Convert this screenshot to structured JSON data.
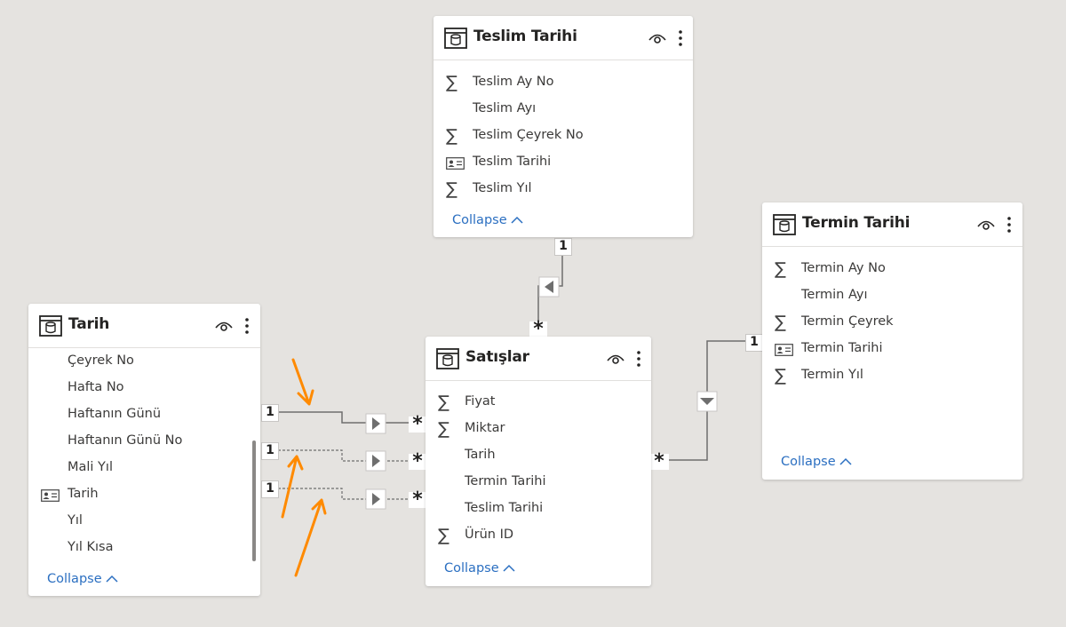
{
  "tables": [
    {
      "key": "teslim",
      "title": "Teslim Tarihi",
      "fields": [
        {
          "icon": "sigma",
          "label": "Teslim Ay No"
        },
        {
          "icon": "none",
          "label": "Teslim Ayı"
        },
        {
          "icon": "sigma",
          "label": "Teslim Çeyrek No"
        },
        {
          "icon": "id-card",
          "label": "Teslim Tarihi"
        },
        {
          "icon": "sigma",
          "label": "Teslim Yıl"
        }
      ],
      "collapse_label": "Collapse"
    },
    {
      "key": "termin",
      "title": "Termin Tarihi",
      "fields": [
        {
          "icon": "sigma",
          "label": "Termin Ay No"
        },
        {
          "icon": "none",
          "label": "Termin Ayı"
        },
        {
          "icon": "sigma",
          "label": "Termin Çeyrek"
        },
        {
          "icon": "id-card",
          "label": "Termin Tarihi"
        },
        {
          "icon": "sigma",
          "label": "Termin Yıl"
        }
      ],
      "collapse_label": "Collapse"
    },
    {
      "key": "tarih",
      "title": "Tarih",
      "fields": [
        {
          "icon": "none",
          "label": "Çeyrek No"
        },
        {
          "icon": "none",
          "label": "Hafta No"
        },
        {
          "icon": "none",
          "label": "Haftanın Günü"
        },
        {
          "icon": "none",
          "label": "Haftanın Günü No"
        },
        {
          "icon": "none",
          "label": "Mali Yıl"
        },
        {
          "icon": "id-card",
          "label": "Tarih"
        },
        {
          "icon": "none",
          "label": "Yıl"
        },
        {
          "icon": "none",
          "label": "Yıl Kısa"
        }
      ],
      "collapse_label": "Collapse"
    },
    {
      "key": "satislar",
      "title": "Satışlar",
      "fields": [
        {
          "icon": "sigma",
          "label": "Fiyat"
        },
        {
          "icon": "sigma",
          "label": "Miktar"
        },
        {
          "icon": "none",
          "label": "Tarih"
        },
        {
          "icon": "none",
          "label": "Termin Tarihi"
        },
        {
          "icon": "none",
          "label": "Teslim Tarihi"
        },
        {
          "icon": "sigma",
          "label": "Ürün ID"
        }
      ],
      "collapse_label": "Collapse"
    }
  ],
  "relationships": [
    {
      "from": "tarih",
      "to": "satislar",
      "from_cardinality": "1",
      "to_cardinality": "*",
      "active": true
    },
    {
      "from": "tarih",
      "to": "satislar",
      "from_cardinality": "1",
      "to_cardinality": "*",
      "active": false
    },
    {
      "from": "tarih",
      "to": "satislar",
      "from_cardinality": "1",
      "to_cardinality": "*",
      "active": false
    },
    {
      "from": "teslim",
      "to": "satislar",
      "from_cardinality": "1",
      "to_cardinality": "*",
      "active": true
    },
    {
      "from": "termin",
      "to": "satislar",
      "from_cardinality": "1",
      "to_cardinality": "*",
      "active": true
    }
  ],
  "annotation_color": "#ff8a00",
  "accent_color": "#2b6fc1"
}
